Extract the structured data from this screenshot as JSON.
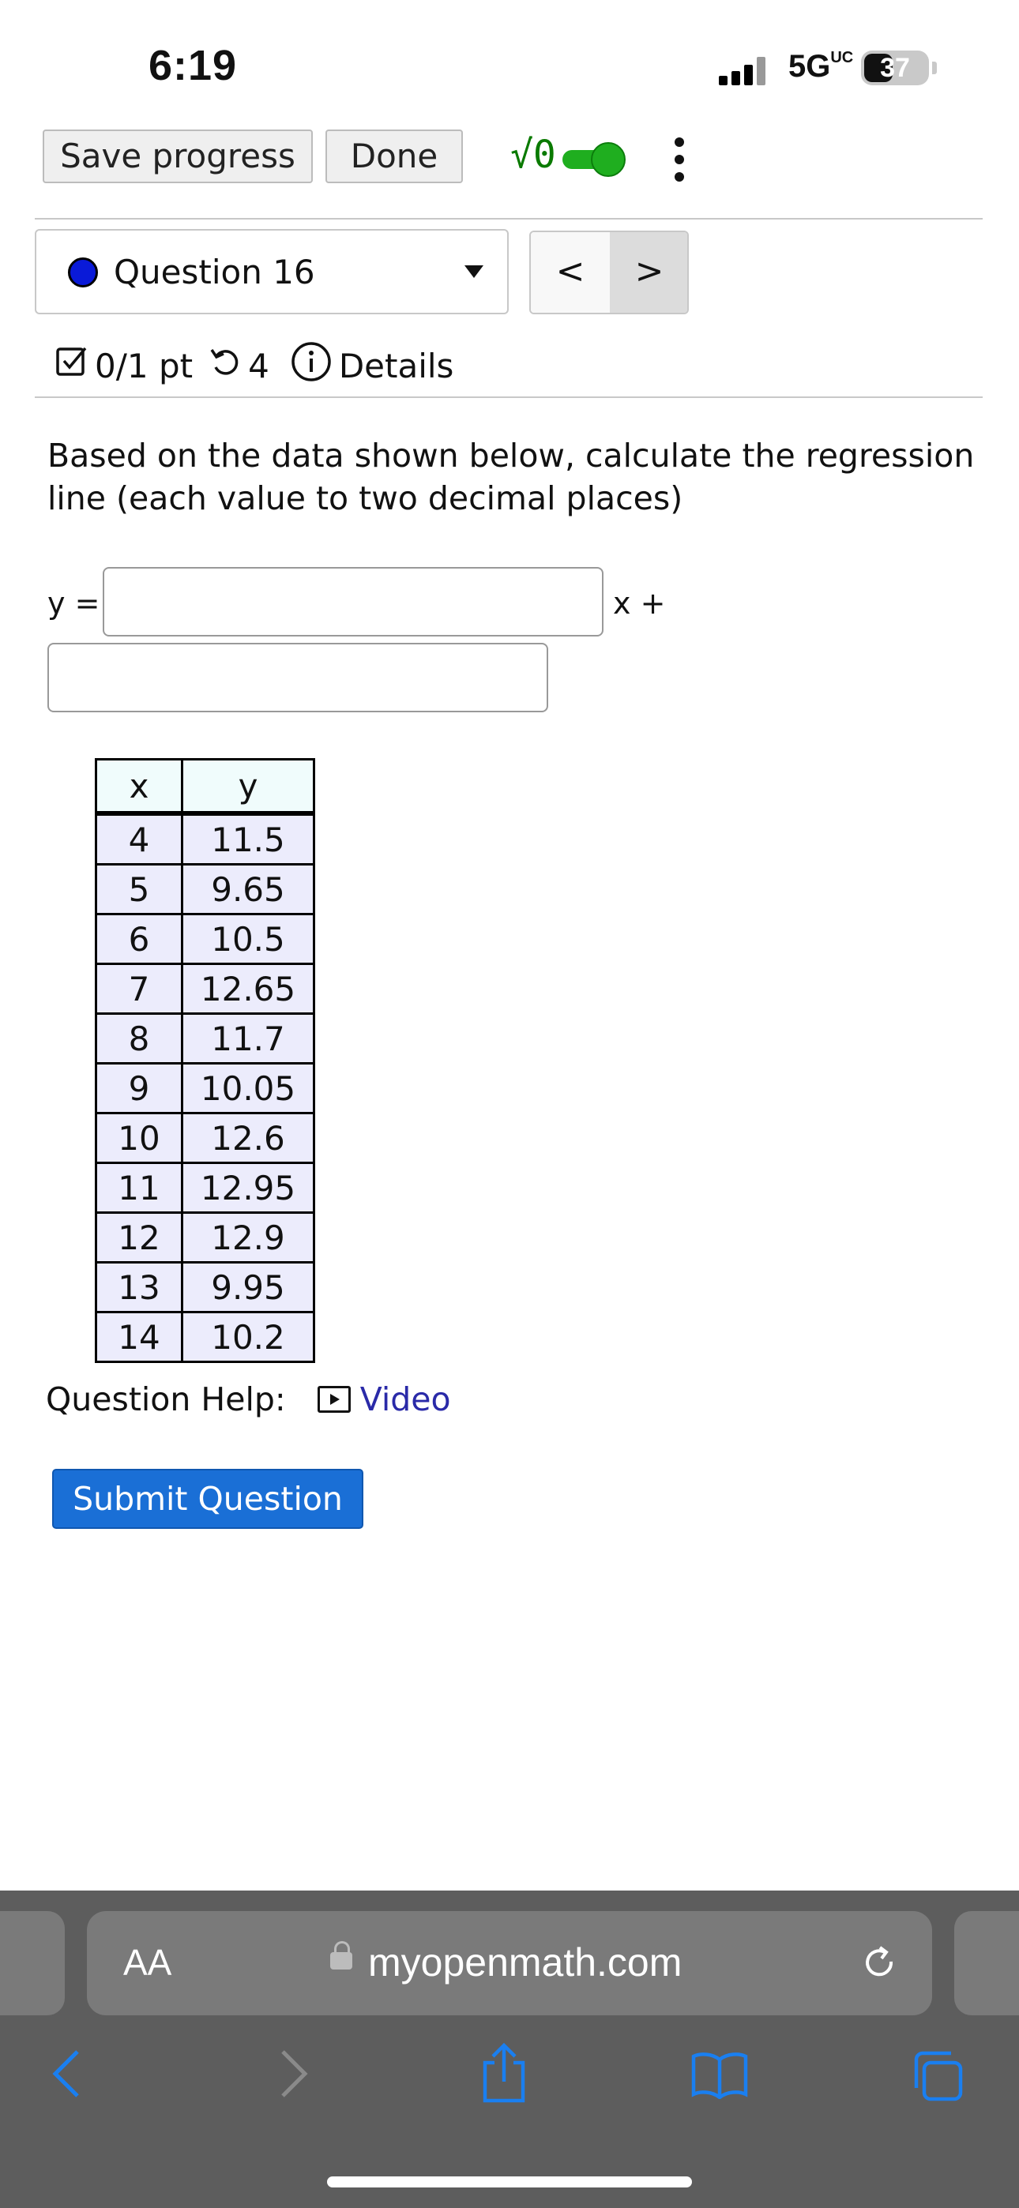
{
  "status_bar": {
    "time": "6:19",
    "network": "5G",
    "network_suffix": "UC",
    "battery": "37"
  },
  "toolbar": {
    "save_label": "Save progress",
    "done_label": "Done",
    "math_logo": "√0"
  },
  "question_nav": {
    "question_label": "Question 16",
    "prev_symbol": "<",
    "next_symbol": ">"
  },
  "score": {
    "points": "0/1 pt",
    "retries": "4",
    "details_label": "Details"
  },
  "question": {
    "prompt": "Based on the data shown below, calculate the regression line (each value to two decimal places)",
    "y_label": "y =",
    "slope_value": "",
    "x_plus_label": "x +",
    "intercept_value": ""
  },
  "table": {
    "headers": [
      "x",
      "y"
    ],
    "rows": [
      [
        "4",
        "11.5"
      ],
      [
        "5",
        "9.65"
      ],
      [
        "6",
        "10.5"
      ],
      [
        "7",
        "12.65"
      ],
      [
        "8",
        "11.7"
      ],
      [
        "9",
        "10.05"
      ],
      [
        "10",
        "12.6"
      ],
      [
        "11",
        "12.95"
      ],
      [
        "12",
        "12.9"
      ],
      [
        "13",
        "9.95"
      ],
      [
        "14",
        "10.2"
      ]
    ]
  },
  "help": {
    "label": "Question Help:",
    "video_label": "Video"
  },
  "submit_label": "Submit Question",
  "browser": {
    "aa_label": "AA",
    "domain": "myopenmath.com"
  },
  "colors": {
    "accent": "#1a6fd6",
    "math_green": "#0a7a00",
    "question_dot": "#0a1ad8",
    "link": "#2a2aa8"
  }
}
